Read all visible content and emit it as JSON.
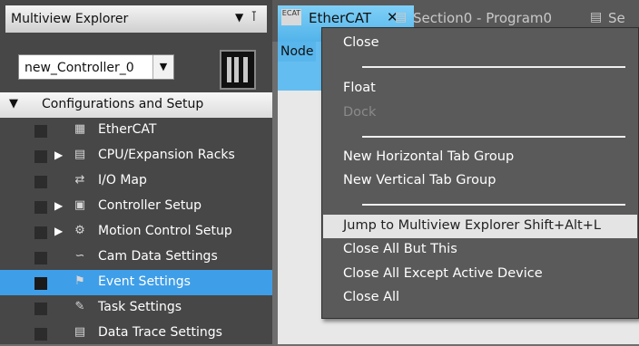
{
  "explorer": {
    "title": "Multiview Explorer",
    "dropdown_icon": "chevron-down-icon",
    "pin_icon": "pin-icon",
    "controller_select": {
      "value": "new_Controller_0",
      "arrow_icon": "chevron-down-icon"
    },
    "controller_icon": "controller-device-icon",
    "tree": {
      "root": {
        "label": "Configurations and Setup",
        "expanded": true
      },
      "items": [
        {
          "label": "EtherCAT",
          "icon": "ethercat-icon",
          "expandable": false
        },
        {
          "label": "CPU/Expansion Racks",
          "icon": "rack-icon",
          "expandable": true
        },
        {
          "label": "I/O Map",
          "icon": "io-map-icon",
          "expandable": false
        },
        {
          "label": "Controller Setup",
          "icon": "controller-setup-icon",
          "expandable": true
        },
        {
          "label": "Motion Control Setup",
          "icon": "gear-icon",
          "expandable": true
        },
        {
          "label": "Cam Data Settings",
          "icon": "cam-icon",
          "expandable": false
        },
        {
          "label": "Event Settings",
          "icon": "flag-icon",
          "expandable": false,
          "selected": true
        },
        {
          "label": "Task Settings",
          "icon": "task-icon",
          "expandable": false
        },
        {
          "label": "Data Trace Settings",
          "icon": "trace-icon",
          "expandable": false
        }
      ]
    }
  },
  "tabs": [
    {
      "label": "EtherCAT",
      "icon": "ethercat-icon",
      "active": true,
      "close_icon": "close-icon",
      "icon_text": "ECAT"
    },
    {
      "label": "Section0 - Program0",
      "icon": "program-section-icon",
      "active": false
    },
    {
      "label": "Se",
      "icon": "program-section-icon",
      "active": false
    }
  ],
  "document": {
    "column_header": "Node"
  },
  "context_menu": {
    "items": [
      {
        "label": "Close",
        "enabled": true
      },
      {
        "separator": true
      },
      {
        "label": "Float",
        "enabled": true
      },
      {
        "label": "Dock",
        "enabled": false
      },
      {
        "separator": true
      },
      {
        "label": "New Horizontal Tab Group",
        "enabled": true
      },
      {
        "label": "New Vertical Tab Group",
        "enabled": true
      },
      {
        "separator": true
      },
      {
        "label": "Jump to Multiview Explorer Shift+Alt+L",
        "enabled": true,
        "highlighted": true
      },
      {
        "label": "Close All But This",
        "enabled": true
      },
      {
        "label": "Close All Except Active Device",
        "enabled": true
      },
      {
        "label": "Close All",
        "enabled": true
      }
    ]
  },
  "colors": {
    "panel_bg": "#474747",
    "selection": "#3f9ee8",
    "active_tab": "#64bdf0",
    "menu_bg": "#5a5a5a",
    "menu_highlight": "#e4e4e4"
  }
}
